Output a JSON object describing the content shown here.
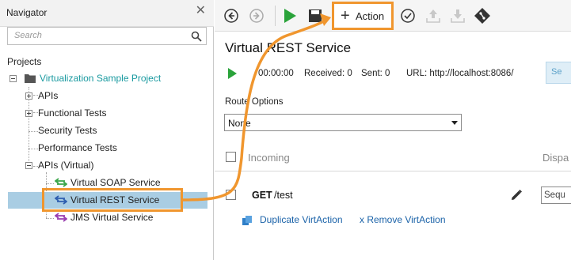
{
  "navigator": {
    "title": "Navigator",
    "search_placeholder": "Search",
    "projects_label": "Projects",
    "tree": [
      {
        "label": "Virtualization Sample Project",
        "color": "#1a9aa0"
      },
      {
        "label": "APIs"
      },
      {
        "label": "Functional Tests"
      },
      {
        "label": "Security Tests"
      },
      {
        "label": "Performance Tests"
      },
      {
        "label": "APIs (Virtual)"
      },
      {
        "label": "Virtual SOAP Service"
      },
      {
        "label": "Virtual REST Service"
      },
      {
        "label": "JMS Virtual Service"
      }
    ]
  },
  "toolbar": {
    "action_label": "Action"
  },
  "service": {
    "title": "Virtual REST Service",
    "time": "00:00:00",
    "received": "Received: 0",
    "sent": "Sent: 0",
    "url": "URL: http://localhost:8086/",
    "side_button": "Se"
  },
  "route": {
    "label": "Route Options",
    "value": "None"
  },
  "grid": {
    "col_incoming": "Incoming",
    "col_dispatch": "Dispa"
  },
  "row": {
    "method": "GET",
    "path": "/test",
    "dispatch_value": "Sequ",
    "duplicate_link": "Duplicate VirtAction",
    "remove_link": "x Remove VirtAction"
  },
  "colors": {
    "accent": "#f0962e",
    "selected": "#a9cde3",
    "link": "#1a62a8",
    "play": "#2aa33a"
  }
}
